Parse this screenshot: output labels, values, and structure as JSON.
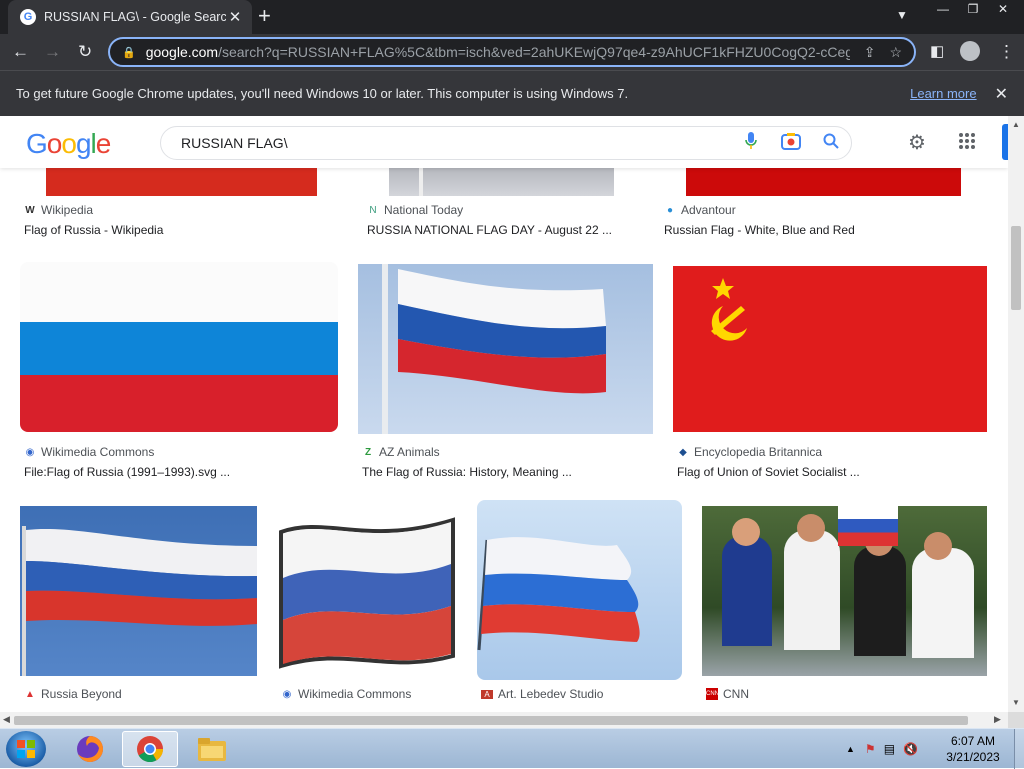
{
  "browser": {
    "tab_title": "RUSSIAN FLAG\\ - Google Search",
    "tab_favicon": "G",
    "url_host": "google.com",
    "url_rest": "/search?q=RUSSIAN+FLAG%5C&tbm=isch&ved=2ahUKEwjQ97qe4-z9AhUCF1kFHZU0CogQ2-cCeg...",
    "infobar_message": "To get future Google Chrome updates, you'll need Windows 10 or later. This computer is using Windows 7.",
    "infobar_link": "Learn more"
  },
  "google": {
    "logo_letters": [
      "G",
      "o",
      "o",
      "g",
      "l",
      "e"
    ],
    "logo_colors": [
      "#4285f4",
      "#ea4335",
      "#fbbc05",
      "#4285f4",
      "#34a853",
      "#ea4335"
    ],
    "query": "RUSSIAN FLAG\\"
  },
  "results": {
    "row1": [
      {
        "source": "Wikipedia",
        "source_icon": "W",
        "caption": "Flag of Russia - Wikipedia"
      },
      {
        "source": "National Today",
        "source_icon": "N",
        "caption": "RUSSIA NATIONAL FLAG DAY - August 22 ..."
      },
      {
        "source": "Advantour",
        "source_icon": "globe",
        "caption": "Russian Flag - White, Blue and Red"
      }
    ],
    "row2": [
      {
        "source": "Wikimedia Commons",
        "source_icon": "wikimedia",
        "caption": "File:Flag of Russia (1991–1993).svg ..."
      },
      {
        "source": "AZ Animals",
        "source_icon": "AZ",
        "caption": "The Flag of Russia: History, Meaning ..."
      },
      {
        "source": "Encyclopedia Britannica",
        "source_icon": "britannica",
        "caption": "Flag of Union of Soviet Socialist ..."
      }
    ],
    "row3": [
      {
        "source": "Russia Beyond",
        "source_icon": "RB"
      },
      {
        "source": "Wikimedia Commons",
        "source_icon": "wikimedia"
      },
      {
        "source": "Art. Lebedev Studio",
        "source_icon": "AL"
      },
      {
        "source": "CNN",
        "source_icon": "CNN"
      }
    ]
  },
  "taskbar": {
    "time": "6:07 AM",
    "date": "3/21/2023"
  }
}
